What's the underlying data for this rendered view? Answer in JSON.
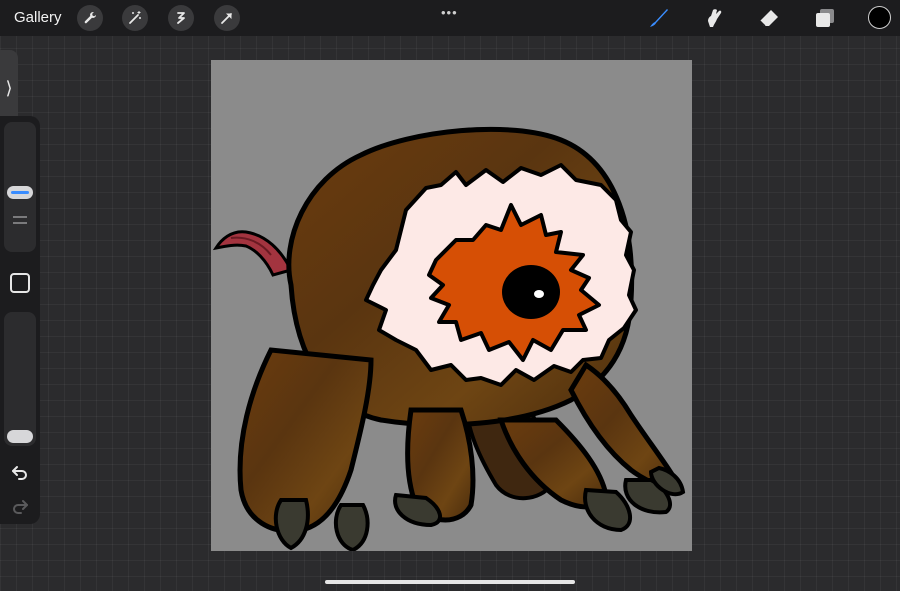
{
  "topbar": {
    "gallery_label": "Gallery",
    "more_menu_label": "•••",
    "left_tools": [
      "wrench-icon",
      "magic-wand-icon",
      "selection-icon",
      "transform-arrow-icon"
    ],
    "right_tools": [
      "brush-icon",
      "smudge-icon",
      "eraser-icon",
      "layers-icon"
    ],
    "current_color": "#000000",
    "active_tool_color": "#3a8dff"
  },
  "sidebar": {
    "toggle_glyph": "⟩",
    "brush_size_level": 0.45,
    "opacity_level": 0.0
  },
  "canvas": {
    "background_color": "#8b8b8b"
  }
}
